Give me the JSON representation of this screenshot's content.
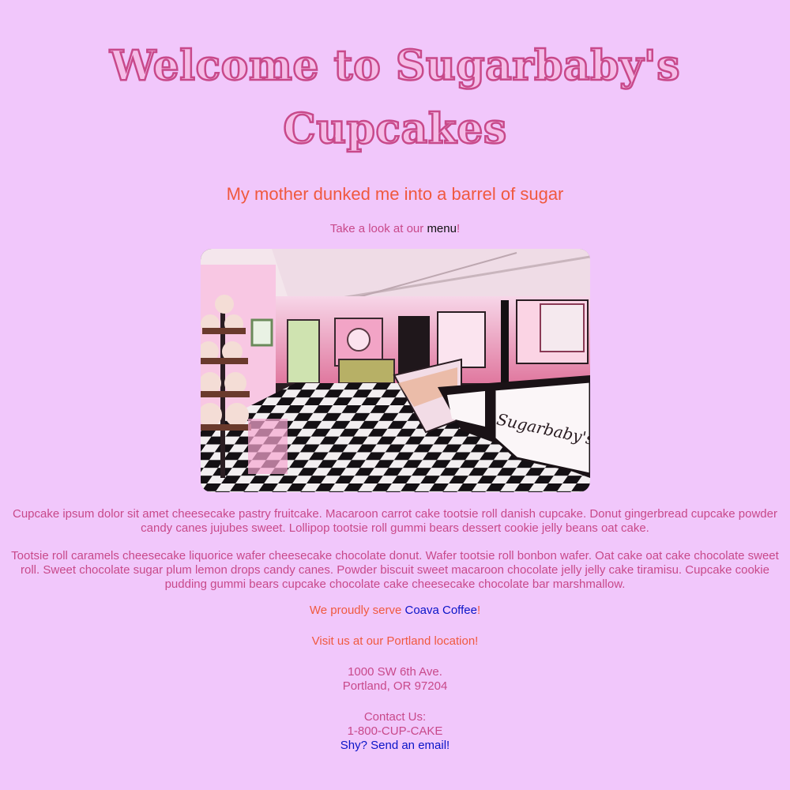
{
  "header": {
    "title_line1": "Welcome to Sugarbaby's",
    "title_line2": "Cupcakes",
    "tagline": "My mother dunked me into a barrel of sugar"
  },
  "menu_line": {
    "prefix": "Take a look at our ",
    "link": "menu",
    "suffix": "!"
  },
  "hero": {
    "sign_text": "Sugarbaby's"
  },
  "paragraphs": [
    "Cupcake ipsum dolor sit amet cheesecake pastry fruitcake. Macaroon carrot cake tootsie roll danish cupcake. Donut gingerbread cupcake powder candy canes jujubes sweet. Lollipop tootsie roll gummi bears dessert cookie jelly beans oat cake.",
    "Tootsie roll caramels cheesecake liquorice wafer cheesecake chocolate donut. Wafer tootsie roll bonbon wafer. Oat cake oat cake chocolate sweet roll. Sweet chocolate sugar plum lemon drops candy canes. Powder biscuit sweet macaroon chocolate jelly jelly cake tiramisu. Cupcake cookie pudding gummi bears cupcake chocolate cake cheesecake chocolate bar marshmallow."
  ],
  "coffee": {
    "prefix": "We proudly serve ",
    "link": "Coava Coffee",
    "suffix": "!"
  },
  "visit": "Visit us at our Portland location!",
  "address": {
    "street": "1000 SW 6th Ave.",
    "city": "Portland, OR 97204"
  },
  "contact": {
    "label": "Contact Us:",
    "phone": "1-800-CUP-CAKE",
    "email_link": "Shy? Send an email!"
  },
  "colors": {
    "background": "#f1c7fb",
    "title": "#c8498a",
    "accent": "#f0593f",
    "link": "#0a14c8"
  }
}
